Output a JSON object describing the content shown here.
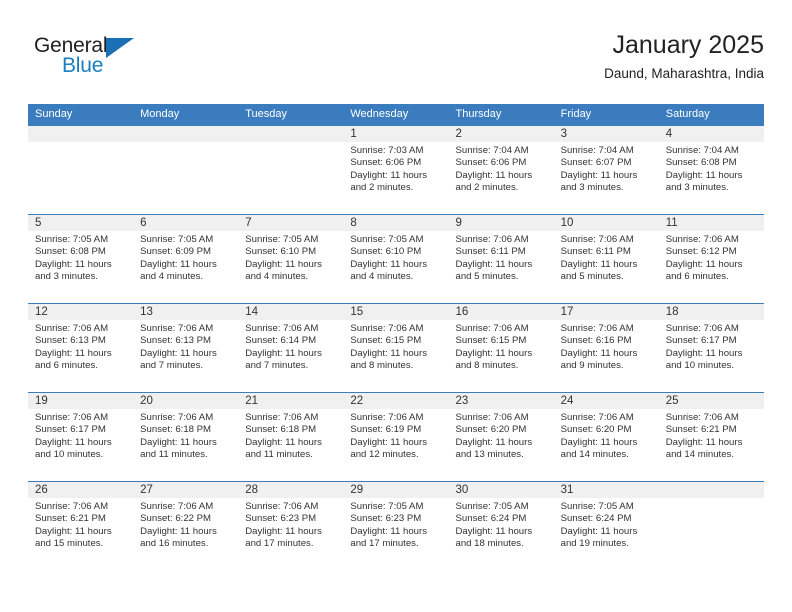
{
  "logo": {
    "word_one": "General",
    "word_two": "Blue",
    "triangle_icon": "triangle-icon",
    "accent_color": "#1a7fc1"
  },
  "header": {
    "title": "January 2025",
    "subtitle": "Daund, Maharashtra, India"
  },
  "theme": {
    "header_blue": "#3b7cbe",
    "band_gray": "#f0f0f0",
    "text": "#333333"
  },
  "calendar": {
    "weekday_headers": [
      "Sunday",
      "Monday",
      "Tuesday",
      "Wednesday",
      "Thursday",
      "Friday",
      "Saturday"
    ],
    "weeks": [
      [
        {
          "day": "",
          "sunrise": "",
          "sunset": "",
          "daylight_a": "",
          "daylight_b": ""
        },
        {
          "day": "",
          "sunrise": "",
          "sunset": "",
          "daylight_a": "",
          "daylight_b": ""
        },
        {
          "day": "",
          "sunrise": "",
          "sunset": "",
          "daylight_a": "",
          "daylight_b": ""
        },
        {
          "day": "1",
          "sunrise": "Sunrise: 7:03 AM",
          "sunset": "Sunset: 6:06 PM",
          "daylight_a": "Daylight: 11 hours",
          "daylight_b": "and 2 minutes."
        },
        {
          "day": "2",
          "sunrise": "Sunrise: 7:04 AM",
          "sunset": "Sunset: 6:06 PM",
          "daylight_a": "Daylight: 11 hours",
          "daylight_b": "and 2 minutes."
        },
        {
          "day": "3",
          "sunrise": "Sunrise: 7:04 AM",
          "sunset": "Sunset: 6:07 PM",
          "daylight_a": "Daylight: 11 hours",
          "daylight_b": "and 3 minutes."
        },
        {
          "day": "4",
          "sunrise": "Sunrise: 7:04 AM",
          "sunset": "Sunset: 6:08 PM",
          "daylight_a": "Daylight: 11 hours",
          "daylight_b": "and 3 minutes."
        }
      ],
      [
        {
          "day": "5",
          "sunrise": "Sunrise: 7:05 AM",
          "sunset": "Sunset: 6:08 PM",
          "daylight_a": "Daylight: 11 hours",
          "daylight_b": "and 3 minutes."
        },
        {
          "day": "6",
          "sunrise": "Sunrise: 7:05 AM",
          "sunset": "Sunset: 6:09 PM",
          "daylight_a": "Daylight: 11 hours",
          "daylight_b": "and 4 minutes."
        },
        {
          "day": "7",
          "sunrise": "Sunrise: 7:05 AM",
          "sunset": "Sunset: 6:10 PM",
          "daylight_a": "Daylight: 11 hours",
          "daylight_b": "and 4 minutes."
        },
        {
          "day": "8",
          "sunrise": "Sunrise: 7:05 AM",
          "sunset": "Sunset: 6:10 PM",
          "daylight_a": "Daylight: 11 hours",
          "daylight_b": "and 4 minutes."
        },
        {
          "day": "9",
          "sunrise": "Sunrise: 7:06 AM",
          "sunset": "Sunset: 6:11 PM",
          "daylight_a": "Daylight: 11 hours",
          "daylight_b": "and 5 minutes."
        },
        {
          "day": "10",
          "sunrise": "Sunrise: 7:06 AM",
          "sunset": "Sunset: 6:11 PM",
          "daylight_a": "Daylight: 11 hours",
          "daylight_b": "and 5 minutes."
        },
        {
          "day": "11",
          "sunrise": "Sunrise: 7:06 AM",
          "sunset": "Sunset: 6:12 PM",
          "daylight_a": "Daylight: 11 hours",
          "daylight_b": "and 6 minutes."
        }
      ],
      [
        {
          "day": "12",
          "sunrise": "Sunrise: 7:06 AM",
          "sunset": "Sunset: 6:13 PM",
          "daylight_a": "Daylight: 11 hours",
          "daylight_b": "and 6 minutes."
        },
        {
          "day": "13",
          "sunrise": "Sunrise: 7:06 AM",
          "sunset": "Sunset: 6:13 PM",
          "daylight_a": "Daylight: 11 hours",
          "daylight_b": "and 7 minutes."
        },
        {
          "day": "14",
          "sunrise": "Sunrise: 7:06 AM",
          "sunset": "Sunset: 6:14 PM",
          "daylight_a": "Daylight: 11 hours",
          "daylight_b": "and 7 minutes."
        },
        {
          "day": "15",
          "sunrise": "Sunrise: 7:06 AM",
          "sunset": "Sunset: 6:15 PM",
          "daylight_a": "Daylight: 11 hours",
          "daylight_b": "and 8 minutes."
        },
        {
          "day": "16",
          "sunrise": "Sunrise: 7:06 AM",
          "sunset": "Sunset: 6:15 PM",
          "daylight_a": "Daylight: 11 hours",
          "daylight_b": "and 8 minutes."
        },
        {
          "day": "17",
          "sunrise": "Sunrise: 7:06 AM",
          "sunset": "Sunset: 6:16 PM",
          "daylight_a": "Daylight: 11 hours",
          "daylight_b": "and 9 minutes."
        },
        {
          "day": "18",
          "sunrise": "Sunrise: 7:06 AM",
          "sunset": "Sunset: 6:17 PM",
          "daylight_a": "Daylight: 11 hours",
          "daylight_b": "and 10 minutes."
        }
      ],
      [
        {
          "day": "19",
          "sunrise": "Sunrise: 7:06 AM",
          "sunset": "Sunset: 6:17 PM",
          "daylight_a": "Daylight: 11 hours",
          "daylight_b": "and 10 minutes."
        },
        {
          "day": "20",
          "sunrise": "Sunrise: 7:06 AM",
          "sunset": "Sunset: 6:18 PM",
          "daylight_a": "Daylight: 11 hours",
          "daylight_b": "and 11 minutes."
        },
        {
          "day": "21",
          "sunrise": "Sunrise: 7:06 AM",
          "sunset": "Sunset: 6:18 PM",
          "daylight_a": "Daylight: 11 hours",
          "daylight_b": "and 11 minutes."
        },
        {
          "day": "22",
          "sunrise": "Sunrise: 7:06 AM",
          "sunset": "Sunset: 6:19 PM",
          "daylight_a": "Daylight: 11 hours",
          "daylight_b": "and 12 minutes."
        },
        {
          "day": "23",
          "sunrise": "Sunrise: 7:06 AM",
          "sunset": "Sunset: 6:20 PM",
          "daylight_a": "Daylight: 11 hours",
          "daylight_b": "and 13 minutes."
        },
        {
          "day": "24",
          "sunrise": "Sunrise: 7:06 AM",
          "sunset": "Sunset: 6:20 PM",
          "daylight_a": "Daylight: 11 hours",
          "daylight_b": "and 14 minutes."
        },
        {
          "day": "25",
          "sunrise": "Sunrise: 7:06 AM",
          "sunset": "Sunset: 6:21 PM",
          "daylight_a": "Daylight: 11 hours",
          "daylight_b": "and 14 minutes."
        }
      ],
      [
        {
          "day": "26",
          "sunrise": "Sunrise: 7:06 AM",
          "sunset": "Sunset: 6:21 PM",
          "daylight_a": "Daylight: 11 hours",
          "daylight_b": "and 15 minutes."
        },
        {
          "day": "27",
          "sunrise": "Sunrise: 7:06 AM",
          "sunset": "Sunset: 6:22 PM",
          "daylight_a": "Daylight: 11 hours",
          "daylight_b": "and 16 minutes."
        },
        {
          "day": "28",
          "sunrise": "Sunrise: 7:06 AM",
          "sunset": "Sunset: 6:23 PM",
          "daylight_a": "Daylight: 11 hours",
          "daylight_b": "and 17 minutes."
        },
        {
          "day": "29",
          "sunrise": "Sunrise: 7:05 AM",
          "sunset": "Sunset: 6:23 PM",
          "daylight_a": "Daylight: 11 hours",
          "daylight_b": "and 17 minutes."
        },
        {
          "day": "30",
          "sunrise": "Sunrise: 7:05 AM",
          "sunset": "Sunset: 6:24 PM",
          "daylight_a": "Daylight: 11 hours",
          "daylight_b": "and 18 minutes."
        },
        {
          "day": "31",
          "sunrise": "Sunrise: 7:05 AM",
          "sunset": "Sunset: 6:24 PM",
          "daylight_a": "Daylight: 11 hours",
          "daylight_b": "and 19 minutes."
        },
        {
          "day": "",
          "sunrise": "",
          "sunset": "",
          "daylight_a": "",
          "daylight_b": ""
        }
      ]
    ]
  }
}
